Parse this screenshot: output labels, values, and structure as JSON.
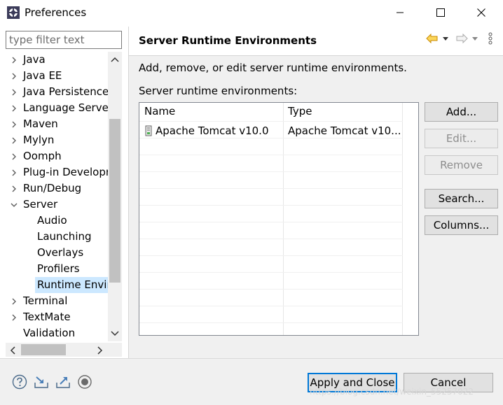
{
  "window": {
    "title": "Preferences"
  },
  "filter": {
    "placeholder": "type filter text"
  },
  "tree": {
    "items": [
      {
        "label": "Java"
      },
      {
        "label": "Java EE"
      },
      {
        "label": "Java Persistence"
      },
      {
        "label": "Language Server"
      },
      {
        "label": "Maven"
      },
      {
        "label": "Mylyn"
      },
      {
        "label": "Oomph"
      },
      {
        "label": "Plug-in Developr"
      },
      {
        "label": "Run/Debug"
      },
      {
        "label": "Server"
      },
      {
        "label": "Audio"
      },
      {
        "label": "Launching"
      },
      {
        "label": "Overlays"
      },
      {
        "label": "Profilers"
      },
      {
        "label": "Runtime Envir"
      },
      {
        "label": "Terminal"
      },
      {
        "label": "TextMate"
      },
      {
        "label": "Validation"
      }
    ]
  },
  "page": {
    "title": "Server Runtime Environments",
    "description": "Add, remove, or edit server runtime environments.",
    "list_label": "Server runtime environments:"
  },
  "table": {
    "headers": [
      "Name",
      "Type"
    ],
    "rows": [
      {
        "name": "Apache Tomcat v10.0",
        "type": "Apache Tomcat v10..."
      }
    ]
  },
  "buttons": {
    "add": "Add...",
    "edit": "Edit...",
    "remove": "Remove",
    "search": "Search...",
    "columns": "Columns..."
  },
  "footer": {
    "apply_close": "Apply and Close",
    "cancel": "Cancel",
    "watermark": "https://blog.csdn.net/weixin_55257022"
  },
  "colors": {
    "accent": "#0078d7",
    "selection": "#cce8ff",
    "back_arrow": "#e8a200"
  }
}
